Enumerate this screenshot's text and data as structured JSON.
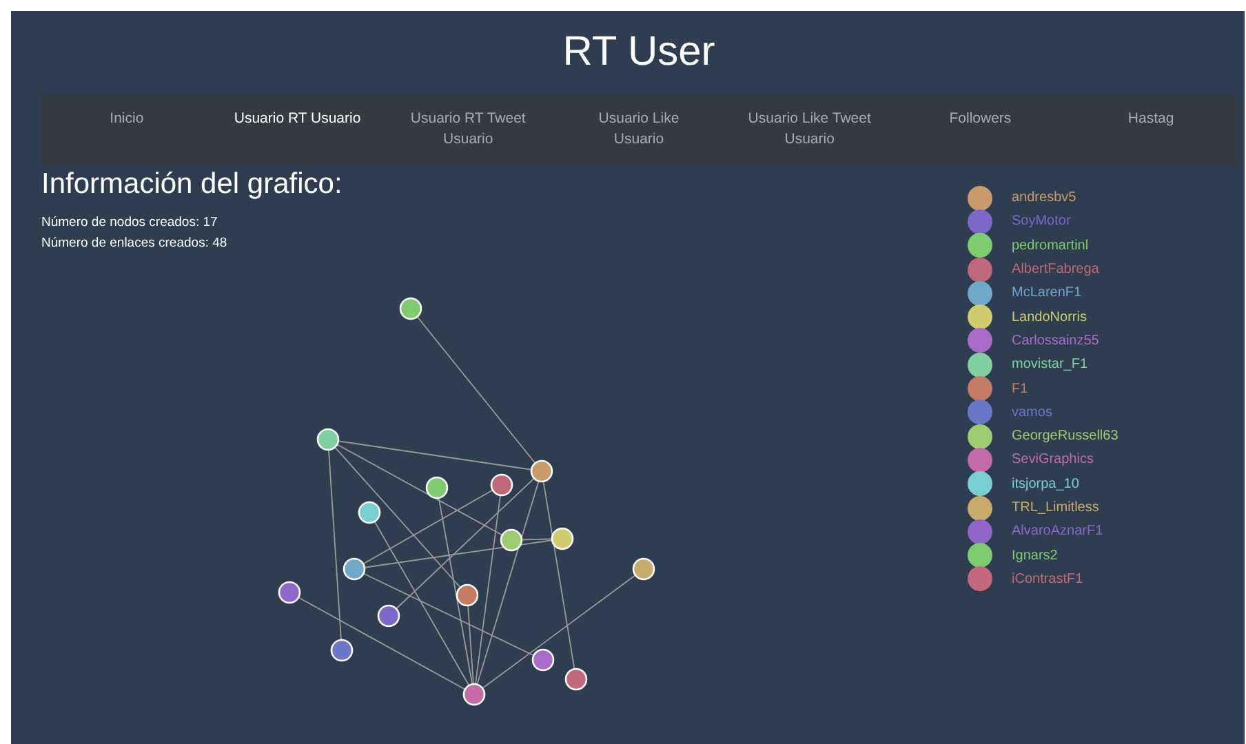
{
  "title": "RT User",
  "nav": [
    {
      "label": "Inicio",
      "selected": false
    },
    {
      "label": "Usuario RT Usuario",
      "selected": true
    },
    {
      "label": "Usuario RT Tweet Usuario",
      "selected": false
    },
    {
      "label": "Usuario Like Usuario",
      "selected": false
    },
    {
      "label": "Usuario Like Tweet Usuario",
      "selected": false
    },
    {
      "label": "Followers",
      "selected": false
    },
    {
      "label": "Hastag",
      "selected": false
    }
  ],
  "info": {
    "heading": "Información del grafico:",
    "lines": [
      "Número de nodos creados: 17",
      "Número de enlaces creados: 48"
    ]
  },
  "users": [
    {
      "name": "andresbv5",
      "color": "#c99a6a"
    },
    {
      "name": "SoyMotor",
      "color": "#7b68c8"
    },
    {
      "name": "pedromartinl",
      "color": "#7fcb6f"
    },
    {
      "name": "AlbertFabrega",
      "color": "#c0687a"
    },
    {
      "name": "McLarenF1",
      "color": "#6fa8c8"
    },
    {
      "name": "LandoNorris",
      "color": "#cfcc6f"
    },
    {
      "name": "Carlossainz55",
      "color": "#a96cc9"
    },
    {
      "name": "movistar_F1",
      "color": "#7fcf9f"
    },
    {
      "name": "F1",
      "color": "#c47a63"
    },
    {
      "name": "vamos",
      "color": "#6a76c8"
    },
    {
      "name": "GeorgeRussell63",
      "color": "#9fcb6f"
    },
    {
      "name": "SeviGraphics",
      "color": "#c46aa8"
    },
    {
      "name": "itsjorpa_10",
      "color": "#78cfcf"
    },
    {
      "name": "TRL_Limitless",
      "color": "#c8ab6a"
    },
    {
      "name": "AlvaroAznarF1",
      "color": "#8f66c9"
    },
    {
      "name": "Ignars2",
      "color": "#7fcb70"
    },
    {
      "name": "iContrastF1",
      "color": "#c4687b"
    }
  ]
}
